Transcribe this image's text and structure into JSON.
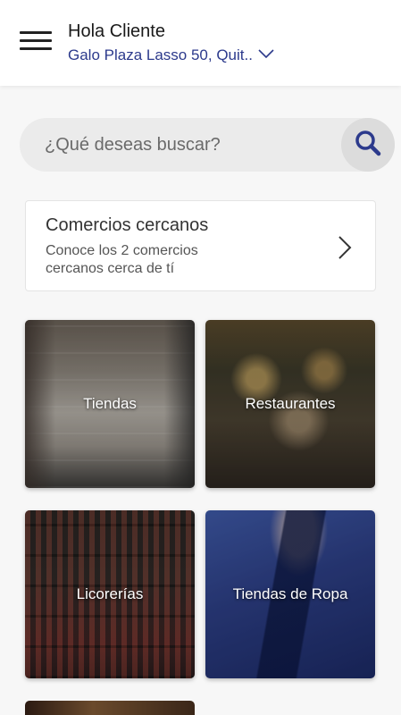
{
  "header": {
    "greeting": "Hola Cliente",
    "address": "Galo Plaza Lasso 50, Quit..",
    "icons": {
      "menu": "hamburger-menu-icon",
      "address_toggle": "chevron-down-icon"
    }
  },
  "search": {
    "placeholder": "¿Qué deseas buscar?",
    "value": "",
    "button_icon": "search-icon"
  },
  "nearby": {
    "title": "Comercios cercanos",
    "description": "Conoce los 2 comercios cercanos cerca de tí",
    "icon": "chevron-right-icon"
  },
  "categories": [
    {
      "label": "Tiendas"
    },
    {
      "label": "Restaurantes"
    },
    {
      "label": "Licorerías"
    },
    {
      "label": "Tiendas de Ropa"
    },
    {
      "label": ""
    }
  ],
  "colors": {
    "accent": "#2c3a8c",
    "background": "#f7f7f7",
    "search_bg": "#ebebeb",
    "search_button_bg": "#dcdcdc"
  }
}
